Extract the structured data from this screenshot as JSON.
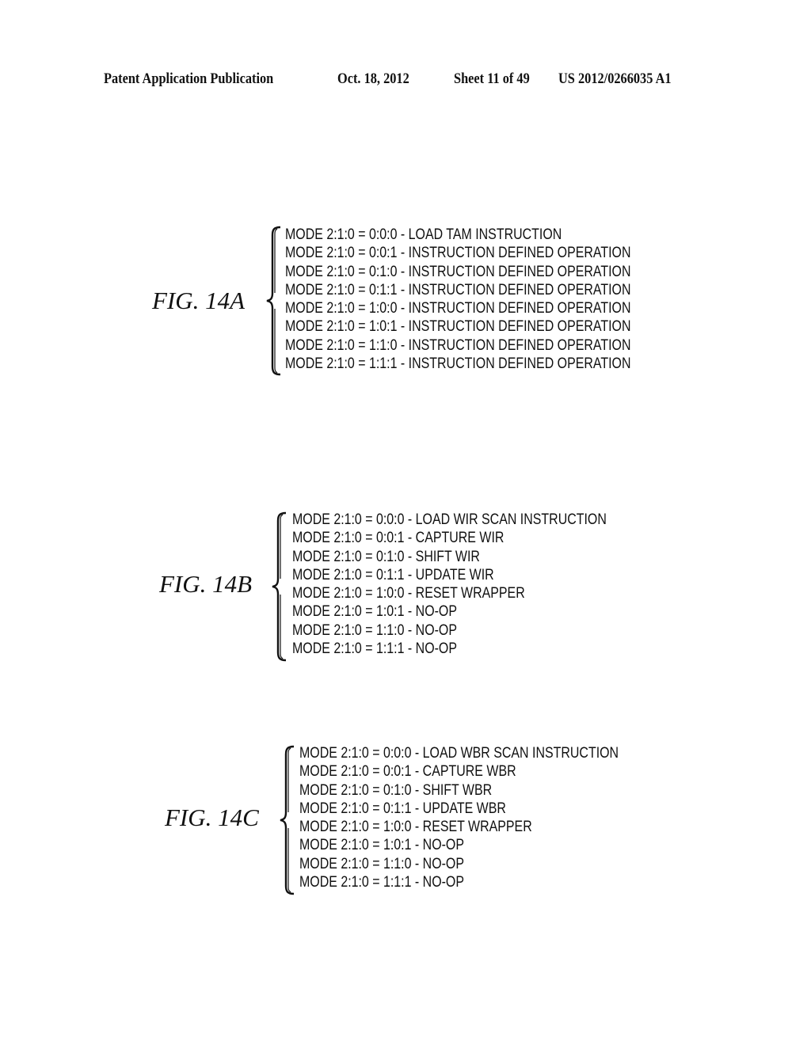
{
  "header": {
    "publication": "Patent Application Publication",
    "date": "Oct. 18, 2012",
    "sheet": "Sheet 11 of 49",
    "number": "US 2012/0266035 A1"
  },
  "figures": [
    {
      "label": "FIG. 14A",
      "rows": [
        "MODE 2:1:0 = 0:0:0 - LOAD TAM INSTRUCTION",
        "MODE 2:1:0 = 0:0:1 - INSTRUCTION DEFINED OPERATION",
        "MODE 2:1:0 = 0:1:0 - INSTRUCTION DEFINED OPERATION",
        "MODE 2:1:0 = 0:1:1 - INSTRUCTION DEFINED OPERATION",
        "MODE 2:1:0 = 1:0:0 - INSTRUCTION DEFINED OPERATION",
        "MODE 2:1:0 = 1:0:1 - INSTRUCTION DEFINED OPERATION",
        "MODE 2:1:0 = 1:1:0 - INSTRUCTION DEFINED OPERATION",
        "MODE 2:1:0 = 1:1:1 - INSTRUCTION DEFINED OPERATION"
      ]
    },
    {
      "label": "FIG. 14B",
      "rows": [
        "MODE 2:1:0 = 0:0:0 - LOAD WIR SCAN INSTRUCTION",
        "MODE 2:1:0 = 0:0:1 - CAPTURE WIR",
        "MODE 2:1:0 = 0:1:0 - SHIFT WIR",
        "MODE 2:1:0 = 0:1:1 - UPDATE WIR",
        "MODE 2:1:0 = 1:0:0 - RESET WRAPPER",
        "MODE 2:1:0 = 1:0:1 - NO-OP",
        "MODE 2:1:0 = 1:1:0 - NO-OP",
        "MODE 2:1:0 = 1:1:1 - NO-OP"
      ]
    },
    {
      "label": "FIG. 14C",
      "rows": [
        "MODE 2:1:0 = 0:0:0 - LOAD WBR SCAN INSTRUCTION",
        "MODE 2:1:0 = 0:0:1 - CAPTURE WBR",
        "MODE 2:1:0 = 0:1:0 - SHIFT WBR",
        "MODE 2:1:0 = 0:1:1 - UPDATE WBR",
        "MODE 2:1:0 = 1:0:0 - RESET WRAPPER",
        "MODE 2:1:0 = 1:0:1 - NO-OP",
        "MODE 2:1:0 = 1:1:0 - NO-OP",
        "MODE 2:1:0 = 1:1:1 - NO-OP"
      ]
    }
  ]
}
